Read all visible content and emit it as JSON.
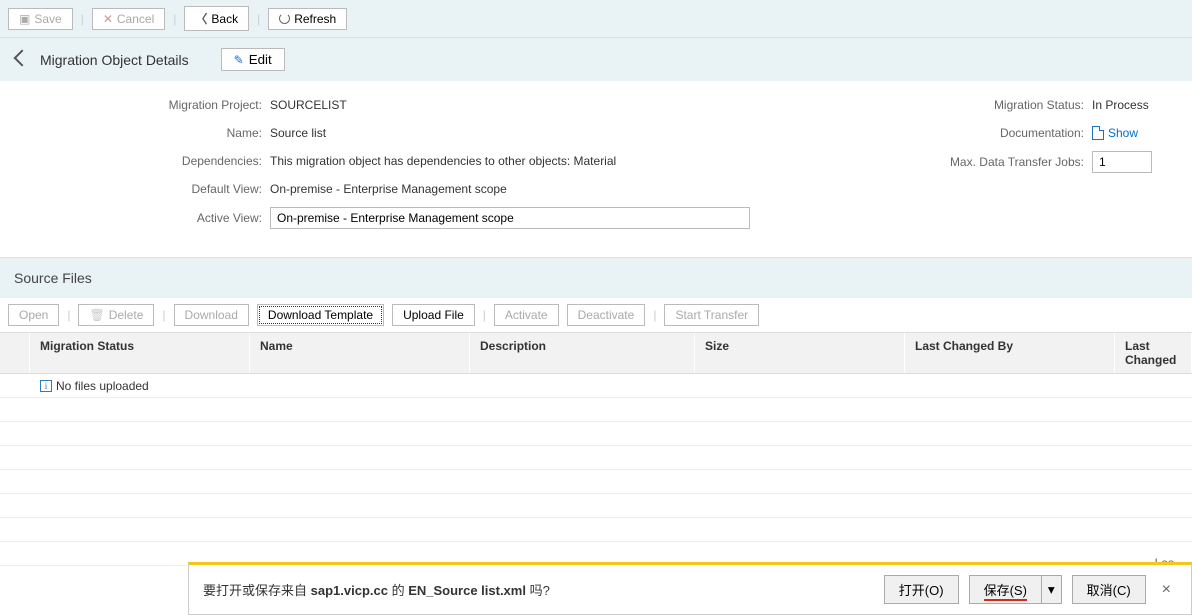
{
  "toolbar": {
    "save": "Save",
    "cancel": "Cancel",
    "back": "Back",
    "refresh": "Refresh"
  },
  "section": {
    "title": "Migration Object Details",
    "edit": "Edit"
  },
  "details": {
    "left": {
      "project_lbl": "Migration Project",
      "project_val": "SOURCELIST",
      "name_lbl": "Name",
      "name_val": "Source list",
      "deps_lbl": "Dependencies",
      "deps_val": "This migration object has dependencies to other objects: Material",
      "defview_lbl": "Default View",
      "defview_val": "On-premise - Enterprise Management scope",
      "actview_lbl": "Active View",
      "actview_val": "On-premise - Enterprise Management scope"
    },
    "right": {
      "status_lbl": "Migration Status",
      "status_val": "In Process",
      "doc_lbl": "Documentation",
      "doc_val": "Show",
      "jobs_lbl": "Max. Data Transfer Jobs",
      "jobs_val": "1"
    }
  },
  "sourcefiles": {
    "title": "Source Files",
    "btns": {
      "open": "Open",
      "delete": "Delete",
      "download": "Download",
      "download_template": "Download Template",
      "upload": "Upload File",
      "activate": "Activate",
      "deactivate": "Deactivate",
      "start_transfer": "Start Transfer"
    },
    "cols": {
      "mig_status": "Migration Status",
      "name": "Name",
      "desc": "Description",
      "size": "Size",
      "last_changed_by": "Last Changed By",
      "last_changed": "Last Changed"
    },
    "empty_msg": "No files uploaded"
  },
  "downloadbar": {
    "pre": "要打开或保存来自 ",
    "host": "sap1.vicp.cc",
    "mid": " 的 ",
    "file": "EN_Source list.xml",
    "post": " 吗?",
    "open": "打开(O)",
    "save": "保存(S)",
    "cancel": "取消(C)"
  },
  "float_status": "Las"
}
